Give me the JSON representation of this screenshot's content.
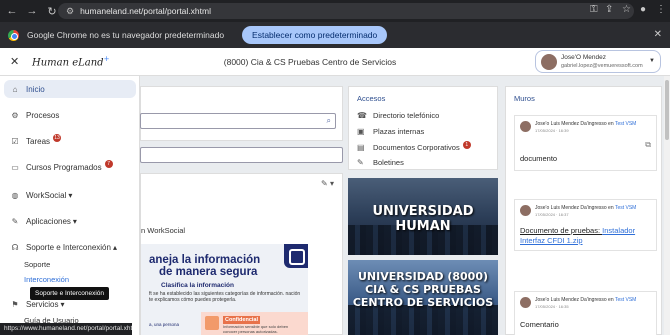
{
  "browser": {
    "url": "humaneland.net/portal/portal.xhtml",
    "infobar_text": "Google Chrome no es tu navegador predeterminado",
    "infobar_button": "Establecer como predeterminado"
  },
  "header": {
    "logo": "Human eLand",
    "title": "(8000) Cia & CS Pruebas Centro de Servicios",
    "user_name": "Jose'O Mendez",
    "user_email": "gabriel.lopez@vemueressoft.com"
  },
  "sidebar": {
    "items": [
      {
        "label": "Inicio",
        "icon": "home-icon"
      },
      {
        "label": "Procesos",
        "icon": "network-icon"
      },
      {
        "label": "Tareas",
        "icon": "checkbox-icon",
        "badge": "13"
      },
      {
        "label": "Cursos Programados",
        "icon": "book-icon",
        "badge": "7"
      },
      {
        "label": "WorkSocial",
        "icon": "globe-icon",
        "caret": "▾"
      },
      {
        "label": "Aplicaciones",
        "icon": "wrench-icon",
        "caret": "▾"
      },
      {
        "label": "Soporte e Interconexión",
        "icon": "headset-icon",
        "caret": "▴"
      },
      {
        "label": "Servicios",
        "icon": "services-icon",
        "caret": "▾"
      }
    ],
    "sub_items": [
      "Soporte",
      "Interconexión",
      "Guía de Usuario"
    ],
    "tooltip": "Soporte e Interconexión",
    "status_url": "https://www.humaneland.net/portal/portal.xhtml#"
  },
  "center": {
    "worksocial_text": "n WorkSocial",
    "poster": {
      "line1": "aneja la información",
      "line2": "de manera segura",
      "subtitle": "Clasifica la información",
      "body": "ft se ha establecido las siguientes categorías de información. nación te explicamos cómo puedes protegerla.",
      "footer": "a, una persona",
      "conf_title": "Confidencial",
      "conf_text": "Información sensible que solo deben conocer personas autorizadas."
    }
  },
  "accesos": {
    "title": "Accesos",
    "items": [
      {
        "label": "Directorio telefónico",
        "icon": "phone-book-icon"
      },
      {
        "label": "Plazas internas",
        "icon": "briefcase-icon"
      },
      {
        "label": "Documentos Corporativos",
        "icon": "folder-icon",
        "badge": "1"
      },
      {
        "label": "Boletines",
        "icon": "edit-icon"
      }
    ],
    "banner1": "UNIVERSIDAD HUMAN",
    "banner2": "UNIVERSIDAD (8000) CIA & CS PRUEBAS CENTRO DE SERVICIOS"
  },
  "muros": {
    "title": "Muros",
    "posts": [
      {
        "author": "Jose'o Luis Mendez Da'ingresso en",
        "target": "Test VSM",
        "date": "17/05/2024 · 16:39",
        "content": "documento",
        "link": ""
      },
      {
        "author": "Jose'o Luis Mendez Da'ingresso en",
        "target": "Test VSM",
        "date": "17/05/2024 · 16:37",
        "content": "Documento de pruebas: ",
        "link": "Instalador Interfaz CFDI 1.zip"
      },
      {
        "author": "Jose'o Luis Mendez Da'ingresso en",
        "target": "Test VSM",
        "date": "17/05/2024 · 16:35",
        "content": "Comentario",
        "link": ""
      }
    ]
  }
}
